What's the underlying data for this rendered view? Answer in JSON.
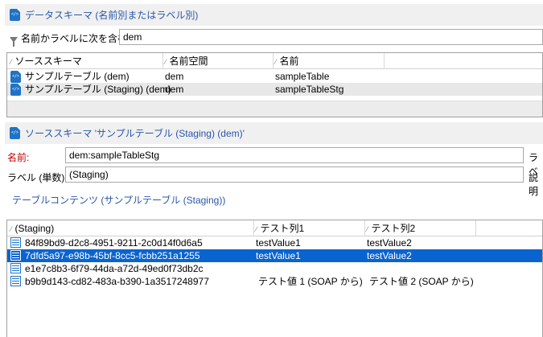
{
  "data_schema": {
    "title": "データスキーマ (名前別またはラベル別)",
    "filter_label": "名前かラベルに次を含む:",
    "filter_value": "dem",
    "columns": [
      "ソーススキーマ",
      "名前空間",
      "名前"
    ],
    "rows": [
      {
        "schema": "サンプルテーブル (dem)",
        "namespace": "dem",
        "name": "sampleTable"
      },
      {
        "schema": "サンプルテーブル (Staging) (dem)",
        "namespace": "dem",
        "name": "sampleTableStg"
      }
    ]
  },
  "source_schema": {
    "title": "ソーススキーマ 'サンプルテーブル (Staging) (dem)'",
    "name_label": "名前:",
    "name_value": "dem:sampleTableStg",
    "name_side_label": "ラベ",
    "label_label": "ラベル (単数):",
    "label_value": "(Staging)",
    "label_side_label": "説明",
    "colors": {
      "name_label": "#c00000",
      "title": "#2a56a8"
    }
  },
  "table_content": {
    "title": "テーブルコンテンツ (サンプルテーブル (Staging))",
    "columns": [
      "(Staging)",
      "テスト列1",
      "テスト列2"
    ],
    "rows": [
      {
        "id": "84f89bd9-d2c8-4951-9211-2c0d14f0d6a5",
        "col1": "testValue1",
        "col2": "testValue2"
      },
      {
        "id": "7dfd5a97-e98b-45bf-8cc5-fcbb251a1255",
        "col1": "testValue1",
        "col2": "testValue2"
      },
      {
        "id": "e1e7c8b3-6f79-44da-a72d-49ed0f73db2c",
        "col1": "",
        "col2": ""
      },
      {
        "id": "b9b9d143-cd82-483a-b390-1a3517248977",
        "col1": "テスト値 1 (SOAP から)",
        "col2": "テスト値 2 (SOAP から)"
      }
    ],
    "selected_color": "#0a64d0"
  }
}
